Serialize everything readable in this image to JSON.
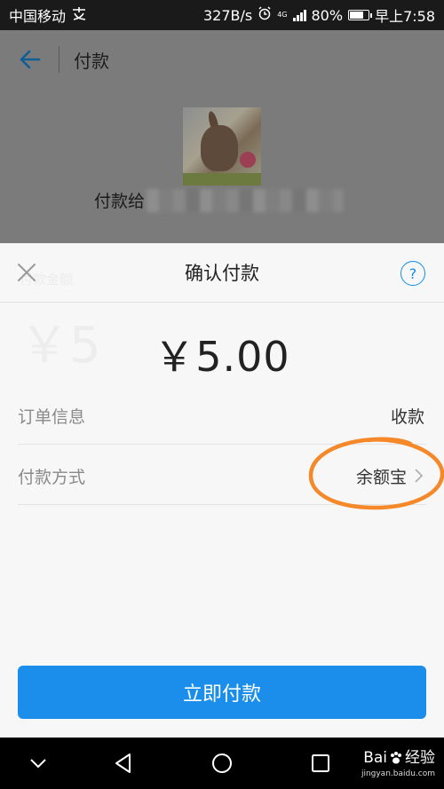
{
  "status_bar": {
    "carrier": "中国移动",
    "carrier_icon": "alipay-notification-icon",
    "speed": "327B/s",
    "network": "4G",
    "battery": "80%",
    "battery_level": 0.8,
    "time": "早上7:58"
  },
  "background_page": {
    "title": "付款",
    "payee_label": "付款给"
  },
  "sheet": {
    "title": "确认付款",
    "help_label": "?",
    "ghost_label": "付款金额",
    "ghost_amount": "￥5",
    "amount": "￥5.00",
    "rows": [
      {
        "label": "订单信息",
        "value": "收款"
      },
      {
        "label": "付款方式",
        "value": "余额宝"
      }
    ],
    "pay_button": "立即付款"
  },
  "watermark": {
    "brand_left": "Bai",
    "brand_right": "经验",
    "url": "jingyan.baidu.com"
  },
  "colors": {
    "accent": "#108ee9",
    "button": "#1a8eea",
    "annotation": "#f5892a"
  }
}
